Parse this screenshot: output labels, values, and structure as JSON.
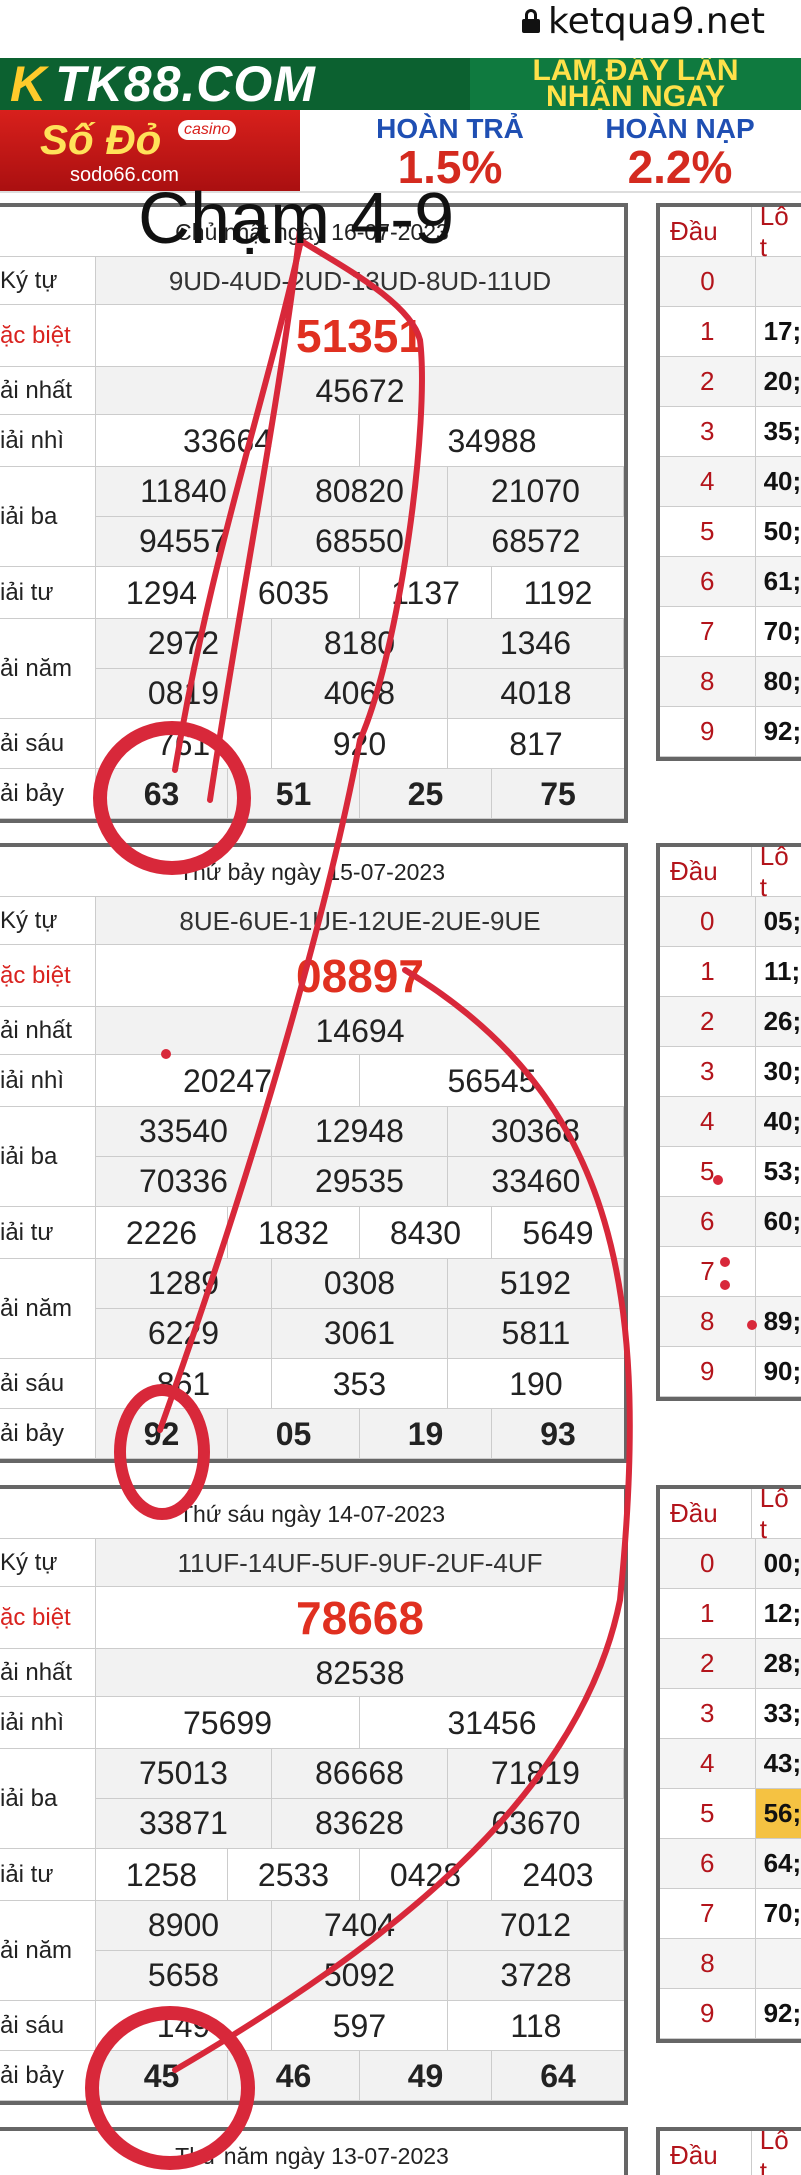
{
  "browser": {
    "url": "ketqua9.net"
  },
  "banners": {
    "tk88": {
      "logo": "TK88.COM",
      "promo_line1": "LÀM ĐẦY LẦN",
      "promo_line2": "NHẬN NGAY"
    },
    "sodo": {
      "name": "Số Đỏ",
      "badge": "casino",
      "site": "sodo66.com"
    },
    "offers": [
      {
        "label": "HOÀN TRẢ",
        "value": "1.5%"
      },
      {
        "label": "HOÀN NẠP",
        "value": "2.2%"
      }
    ]
  },
  "annotation": {
    "title": "Chạm 4-9"
  },
  "labels": {
    "ky_tu": "Ký tự",
    "dac_biet": "ặc biệt",
    "nhat": "ải nhất",
    "nhi": "iải nhì",
    "ba": "iải ba",
    "tu": "iải tư",
    "nam": "ải năm",
    "sau": "ải sáu",
    "bay": "ải bảy",
    "dau": "Đầu",
    "lo": "Lô t"
  },
  "results": [
    {
      "date": "Chủ nhật ngày 16-07-2023",
      "code": "9UD-4UD-2UD-13UD-8UD-11UD",
      "special": "51351",
      "first": [
        "45672"
      ],
      "second": [
        "33664",
        "34988"
      ],
      "third": [
        "11840",
        "80820",
        "21070",
        "94557",
        "68550",
        "68572"
      ],
      "fourth": [
        "1294",
        "6035",
        "1137",
        "1192"
      ],
      "fifth": [
        "2972",
        "8180",
        "1346",
        "0819",
        "4068",
        "4018"
      ],
      "sixth": [
        "761",
        "920",
        "817"
      ],
      "seventh": [
        "63",
        "51",
        "25",
        "75"
      ],
      "table": [
        {
          "d": "0",
          "l": ""
        },
        {
          "d": "1",
          "l": "17;"
        },
        {
          "d": "2",
          "l": "20;"
        },
        {
          "d": "3",
          "l": "35;"
        },
        {
          "d": "4",
          "l": "40;"
        },
        {
          "d": "5",
          "l": "50;"
        },
        {
          "d": "6",
          "l": "61;"
        },
        {
          "d": "7",
          "l": "70;"
        },
        {
          "d": "8",
          "l": "80;"
        },
        {
          "d": "9",
          "l": "92;"
        }
      ]
    },
    {
      "date": "Thứ bảy ngày 15-07-2023",
      "code": "8UE-6UE-1UE-12UE-2UE-9UE",
      "special": "08897",
      "first": [
        "14694"
      ],
      "second": [
        "20247",
        "56545"
      ],
      "third": [
        "33540",
        "12948",
        "30368",
        "70336",
        "29535",
        "33460"
      ],
      "fourth": [
        "2226",
        "1832",
        "8430",
        "5649"
      ],
      "fifth": [
        "1289",
        "0308",
        "5192",
        "6229",
        "3061",
        "5811"
      ],
      "sixth": [
        "861",
        "353",
        "190"
      ],
      "seventh": [
        "92",
        "05",
        "19",
        "93"
      ],
      "table": [
        {
          "d": "0",
          "l": "05;"
        },
        {
          "d": "1",
          "l": "11;"
        },
        {
          "d": "2",
          "l": "26;"
        },
        {
          "d": "3",
          "l": "30;"
        },
        {
          "d": "4",
          "l": "40;"
        },
        {
          "d": "5",
          "l": "53;"
        },
        {
          "d": "6",
          "l": "60;"
        },
        {
          "d": "7",
          "l": ""
        },
        {
          "d": "8",
          "l": "89;"
        },
        {
          "d": "9",
          "l": "90;"
        }
      ]
    },
    {
      "date": "Thứ sáu ngày 14-07-2023",
      "code": "11UF-14UF-5UF-9UF-2UF-4UF",
      "special": "78668",
      "first": [
        "82538"
      ],
      "second": [
        "75699",
        "31456"
      ],
      "third": [
        "75013",
        "86668",
        "71819",
        "33871",
        "83628",
        "63670"
      ],
      "fourth": [
        "1258",
        "2533",
        "0428",
        "2403"
      ],
      "fifth": [
        "8900",
        "7404",
        "7012",
        "5658",
        "5092",
        "3728"
      ],
      "sixth": [
        "149",
        "597",
        "118"
      ],
      "seventh": [
        "45",
        "46",
        "49",
        "64"
      ],
      "table": [
        {
          "d": "0",
          "l": "00;"
        },
        {
          "d": "1",
          "l": "12;"
        },
        {
          "d": "2",
          "l": "28;"
        },
        {
          "d": "3",
          "l": "33;"
        },
        {
          "d": "4",
          "l": "43;"
        },
        {
          "d": "5",
          "l": "56;",
          "hl": true
        },
        {
          "d": "6",
          "l": "64;"
        },
        {
          "d": "7",
          "l": "70;"
        },
        {
          "d": "8",
          "l": ""
        },
        {
          "d": "9",
          "l": "92;"
        }
      ]
    },
    {
      "date": "Thứ năm ngày 13-07-2023"
    }
  ],
  "colors": {
    "special": "#e03020",
    "annotation": "#d8283a",
    "head_red": "#b3141b",
    "highlight": "#f5c242"
  }
}
